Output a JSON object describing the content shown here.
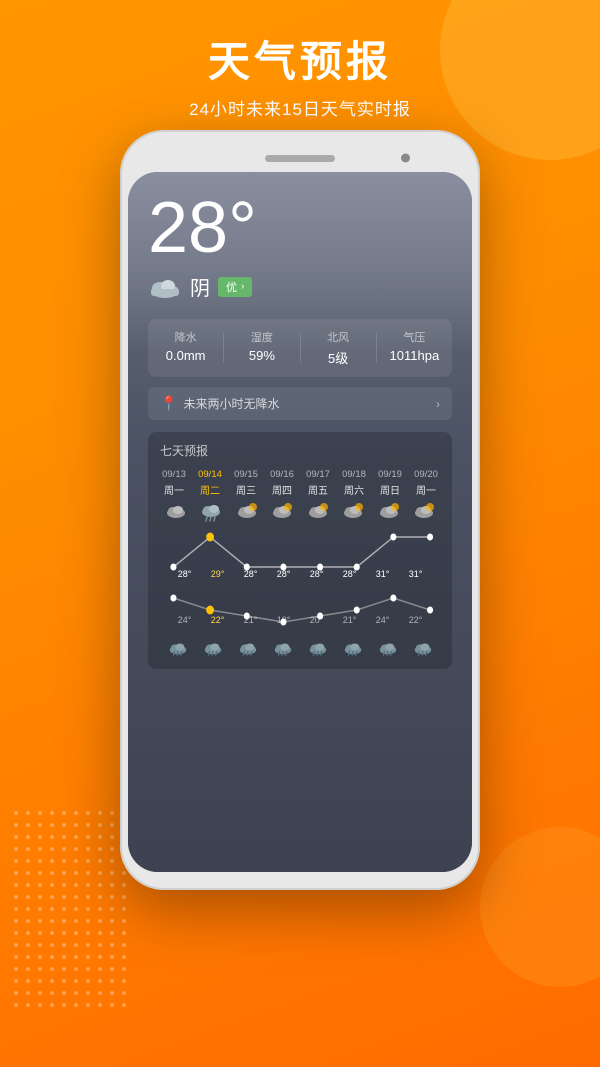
{
  "header": {
    "title": "天气预报",
    "subtitle": "24小时未来15日天气实时报"
  },
  "weather": {
    "temperature": "28°",
    "condition": "阴",
    "aqi_label": "优",
    "stats": [
      {
        "label": "降水",
        "value": "0.0mm"
      },
      {
        "label": "湿度",
        "value": "59%"
      },
      {
        "label": "北风",
        "value": "5级"
      },
      {
        "label": "气压",
        "value": "1011hpa"
      }
    ],
    "precip_notice": "未来两小时无降水",
    "forecast_title": "七天预报",
    "forecast_days": [
      {
        "date": "09/13",
        "weekday": "周一",
        "today": false,
        "high": "28°",
        "low": "24°"
      },
      {
        "date": "09/14",
        "weekday": "周二",
        "today": true,
        "high": "29°",
        "low": "22°"
      },
      {
        "date": "09/15",
        "weekday": "周三",
        "today": false,
        "high": "28°",
        "low": "21°"
      },
      {
        "date": "09/16",
        "weekday": "周四",
        "today": false,
        "high": "28°",
        "low": "19°"
      },
      {
        "date": "09/17",
        "weekday": "周五",
        "today": false,
        "high": "28°",
        "low": "20°"
      },
      {
        "date": "09/18",
        "weekday": "周六",
        "today": false,
        "high": "28°",
        "low": "21°"
      },
      {
        "date": "09/19",
        "weekday": "周日",
        "today": false,
        "high": "31°",
        "low": "24°"
      },
      {
        "date": "09/20",
        "weekday": "周一",
        "today": false,
        "high": "31°",
        "low": "22°"
      }
    ]
  },
  "icons": {
    "cloud": "☁",
    "partly_cloudy": "⛅",
    "cloud_rain": "🌧",
    "chevron_right": "›",
    "location_pin": "📍"
  }
}
